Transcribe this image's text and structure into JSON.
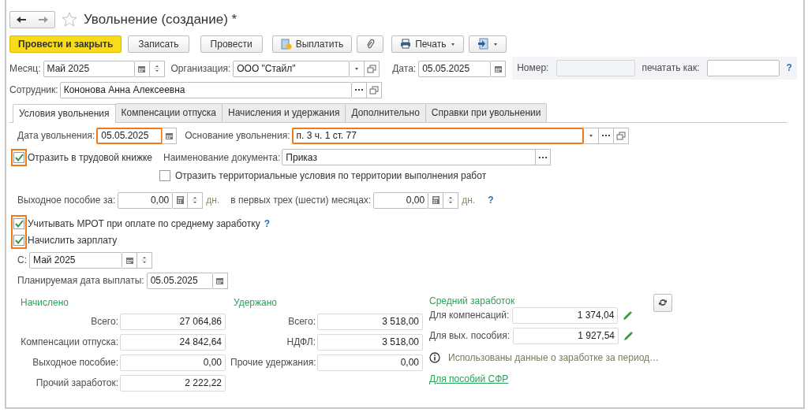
{
  "window": {
    "title": "Увольнение (создание) *",
    "favorite": false
  },
  "toolbar": [
    {
      "kind": "primary",
      "label": "Провести и закрыть"
    },
    {
      "kind": "plain",
      "label": "Записать"
    },
    {
      "kind": "plain",
      "label": "Провести"
    },
    {
      "kind": "pay",
      "label": "Выплатить"
    },
    {
      "kind": "clip"
    },
    {
      "kind": "print",
      "label": "Печать",
      "dropdown": true
    },
    {
      "kind": "export",
      "dropdown": true
    }
  ],
  "header": {
    "month": {
      "label": "Месяц:",
      "value": "Май 2025"
    },
    "organization": {
      "label": "Организация:",
      "value": "ООО \"Стайл\""
    },
    "date": {
      "label": "Дата:",
      "value": "05.05.2025"
    },
    "number": {
      "label": "Номер:",
      "disabled": true
    },
    "print_as": {
      "label": "печатать как:"
    },
    "help": "?",
    "employee": {
      "label": "Сотрудник:",
      "value": "Кононова Анна Алексеевна"
    }
  },
  "tabs": [
    {
      "label": "Условия увольнения",
      "selected": true
    },
    {
      "label": "Компенсации отпуска",
      "selected": false
    },
    {
      "label": "Начисления и удержания",
      "selected": false
    },
    {
      "label": "Дополнительно",
      "selected": false
    },
    {
      "label": "Справки при увольнении",
      "selected": false
    }
  ],
  "dismissal": {
    "date": {
      "label": "Дата увольнения:",
      "value": "05.05.2025",
      "highlighted": true
    },
    "reason": {
      "label": "Основание увольнения:",
      "value": "п. 3 ч. 1 ст. 77",
      "highlighted": true
    },
    "workbook": {
      "label": "Отразить в трудовой книжке",
      "checked": true,
      "highlighted": true
    },
    "doc_name": {
      "label": "Наименование документа:",
      "value": "Приказ"
    },
    "territorial": {
      "label": "Отразить территориальные условия по территории выполнения работ",
      "checked": false
    },
    "severance": {
      "label": "Выходное пособие за:",
      "value": "0,00",
      "unit": "дн."
    },
    "first_months": {
      "label": "в первых трех (шести) месяцах:",
      "value": "0,00",
      "unit": "дн."
    },
    "severance_help": "?",
    "salary_options": {
      "highlighted": true,
      "items": [
        {
          "label": "Учитывать МРОТ при оплате по среднему заработку",
          "checked": true,
          "help": "?"
        },
        {
          "label": "Начислить зарплату",
          "checked": true
        }
      ]
    },
    "from": {
      "label": "С:",
      "value": "Май 2025"
    },
    "payment_date": {
      "label": "Планируемая дата выплаты:",
      "value": "05.05.2025"
    }
  },
  "accrued": {
    "title": "Начислено",
    "rows": [
      {
        "label": "Всего:",
        "value": "27 064,86"
      },
      {
        "label": "Компенсации отпуска:",
        "value": "24 842,64"
      },
      {
        "label": "Выходное пособие:",
        "value": "0,00"
      },
      {
        "label": "Прочий заработок:",
        "value": "2 222,22"
      }
    ]
  },
  "withheld": {
    "title": "Удержано",
    "rows": [
      {
        "label": "Всего:",
        "value": "3 518,00"
      },
      {
        "label": "НДФЛ:",
        "value": "3 518,00"
      },
      {
        "label": "Прочие удержания:",
        "value": "0,00"
      }
    ]
  },
  "average": {
    "title": "Средний заработок",
    "rows": [
      {
        "label": "Для компенсаций:",
        "value": "1 374,04"
      },
      {
        "label": "Для вых. пособия:",
        "value": "1 927,54"
      }
    ],
    "info": "Использованы данные о заработке за период…",
    "link": "Для пособий СФР"
  }
}
